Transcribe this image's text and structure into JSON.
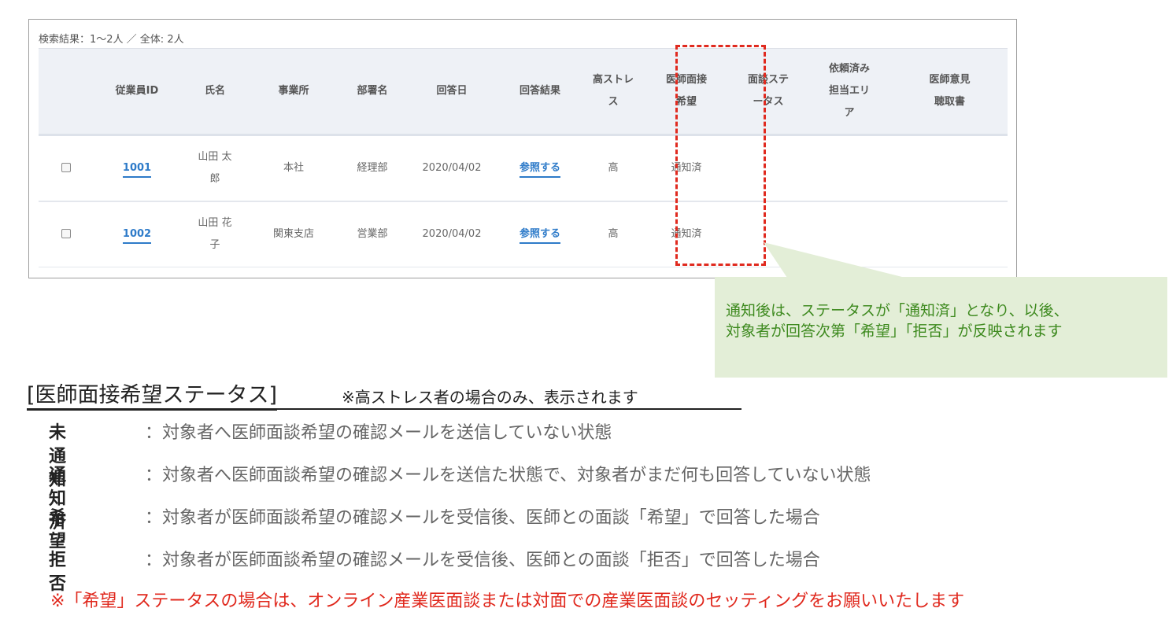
{
  "search_result": "検索結果：1～2人 ／ 全体: 2人",
  "table": {
    "columns": [
      {
        "line1": "",
        "line2": "",
        "line3": ""
      },
      {
        "line1": "従業員ID",
        "line2": "",
        "line3": ""
      },
      {
        "line1": "氏名",
        "line2": "",
        "line3": ""
      },
      {
        "line1": "事業所",
        "line2": "",
        "line3": ""
      },
      {
        "line1": "部署名",
        "line2": "",
        "line3": ""
      },
      {
        "line1": "回答日",
        "line2": "",
        "line3": ""
      },
      {
        "line1": "回答結果",
        "line2": "",
        "line3": ""
      },
      {
        "line1": "高ストレ",
        "line2": "ス",
        "line3": ""
      },
      {
        "line1": "医師面接",
        "line2": "希望",
        "line3": ""
      },
      {
        "line1": "面談ステ",
        "line2": "ータス",
        "line3": ""
      },
      {
        "line1": "依頼済み",
        "line2": "担当エリ",
        "line3": "ア"
      },
      {
        "line1": "医師意見",
        "line2": "聴取書",
        "line3": ""
      }
    ],
    "rows": [
      {
        "employee_id": "1001",
        "name_line1": "山田 太",
        "name_line2": "郎",
        "office": "本社",
        "department": "経理部",
        "answer_date": "2020/04/02",
        "answer_result": "参照する",
        "high_stress": "高",
        "doctor_interview": "通知済",
        "interview_status": "",
        "assigned_area": "",
        "doctor_opinion": ""
      },
      {
        "employee_id": "1002",
        "name_line1": "山田 花",
        "name_line2": "子",
        "office": "関東支店",
        "department": "営業部",
        "answer_date": "2020/04/02",
        "answer_result": "参照する",
        "high_stress": "高",
        "doctor_interview": "通知済",
        "interview_status": "",
        "assigned_area": "",
        "doctor_opinion": ""
      }
    ]
  },
  "callout": {
    "line1": "通知後は、ステータスが「通知済」となり、以後、",
    "line2": "対象者が回答次第「希望」「拒否」が反映されます",
    "bg_color": "#e3eed7",
    "text_color": "#3e8a1f"
  },
  "legend": {
    "title": "[医師面接希望ステータス]",
    "note": "※高ストレス者の場合のみ、表示されます",
    "items": [
      {
        "term": "未通知",
        "desc": "：対象者へ医師面談希望の確認メールを送信していない状態"
      },
      {
        "term": "通知済",
        "desc": "：対象者へ医師面談希望の確認メールを送信た状態で、対象者がまだ何も回答していない状態"
      },
      {
        "term": "希望",
        "desc": "：対象者が医師面談希望の確認メールを受信後、医師との面談「希望」で回答した場合"
      },
      {
        "term": "拒否",
        "desc": "：対象者が医師面談希望の確認メールを受信後、医師との面談「拒否」で回答した場合"
      }
    ],
    "footnote": "※「希望」ステータスの場合は、オンライン産業医面談または対面での産業医面談のセッティングをお願いいたします"
  },
  "colors": {
    "highlight_border": "#e02a1f",
    "link": "#2e7bc9",
    "footnote": "#e0281d"
  }
}
